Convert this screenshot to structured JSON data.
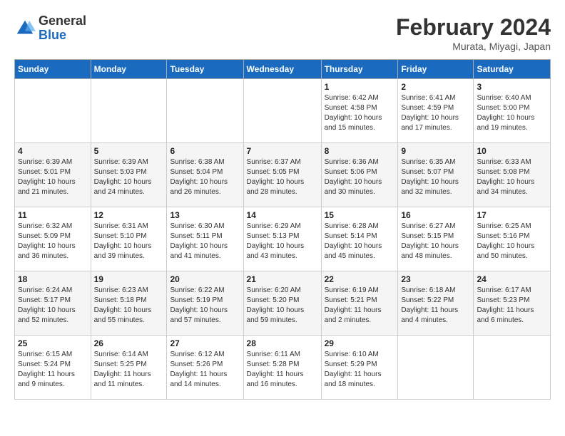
{
  "logo": {
    "general": "General",
    "blue": "Blue"
  },
  "title": {
    "main": "February 2024",
    "sub": "Murata, Miyagi, Japan"
  },
  "calendar": {
    "headers": [
      "Sunday",
      "Monday",
      "Tuesday",
      "Wednesday",
      "Thursday",
      "Friday",
      "Saturday"
    ],
    "weeks": [
      [
        {
          "day": "",
          "info": ""
        },
        {
          "day": "",
          "info": ""
        },
        {
          "day": "",
          "info": ""
        },
        {
          "day": "",
          "info": ""
        },
        {
          "day": "1",
          "info": "Sunrise: 6:42 AM\nSunset: 4:58 PM\nDaylight: 10 hours\nand 15 minutes."
        },
        {
          "day": "2",
          "info": "Sunrise: 6:41 AM\nSunset: 4:59 PM\nDaylight: 10 hours\nand 17 minutes."
        },
        {
          "day": "3",
          "info": "Sunrise: 6:40 AM\nSunset: 5:00 PM\nDaylight: 10 hours\nand 19 minutes."
        }
      ],
      [
        {
          "day": "4",
          "info": "Sunrise: 6:39 AM\nSunset: 5:01 PM\nDaylight: 10 hours\nand 21 minutes."
        },
        {
          "day": "5",
          "info": "Sunrise: 6:39 AM\nSunset: 5:03 PM\nDaylight: 10 hours\nand 24 minutes."
        },
        {
          "day": "6",
          "info": "Sunrise: 6:38 AM\nSunset: 5:04 PM\nDaylight: 10 hours\nand 26 minutes."
        },
        {
          "day": "7",
          "info": "Sunrise: 6:37 AM\nSunset: 5:05 PM\nDaylight: 10 hours\nand 28 minutes."
        },
        {
          "day": "8",
          "info": "Sunrise: 6:36 AM\nSunset: 5:06 PM\nDaylight: 10 hours\nand 30 minutes."
        },
        {
          "day": "9",
          "info": "Sunrise: 6:35 AM\nSunset: 5:07 PM\nDaylight: 10 hours\nand 32 minutes."
        },
        {
          "day": "10",
          "info": "Sunrise: 6:33 AM\nSunset: 5:08 PM\nDaylight: 10 hours\nand 34 minutes."
        }
      ],
      [
        {
          "day": "11",
          "info": "Sunrise: 6:32 AM\nSunset: 5:09 PM\nDaylight: 10 hours\nand 36 minutes."
        },
        {
          "day": "12",
          "info": "Sunrise: 6:31 AM\nSunset: 5:10 PM\nDaylight: 10 hours\nand 39 minutes."
        },
        {
          "day": "13",
          "info": "Sunrise: 6:30 AM\nSunset: 5:11 PM\nDaylight: 10 hours\nand 41 minutes."
        },
        {
          "day": "14",
          "info": "Sunrise: 6:29 AM\nSunset: 5:13 PM\nDaylight: 10 hours\nand 43 minutes."
        },
        {
          "day": "15",
          "info": "Sunrise: 6:28 AM\nSunset: 5:14 PM\nDaylight: 10 hours\nand 45 minutes."
        },
        {
          "day": "16",
          "info": "Sunrise: 6:27 AM\nSunset: 5:15 PM\nDaylight: 10 hours\nand 48 minutes."
        },
        {
          "day": "17",
          "info": "Sunrise: 6:25 AM\nSunset: 5:16 PM\nDaylight: 10 hours\nand 50 minutes."
        }
      ],
      [
        {
          "day": "18",
          "info": "Sunrise: 6:24 AM\nSunset: 5:17 PM\nDaylight: 10 hours\nand 52 minutes."
        },
        {
          "day": "19",
          "info": "Sunrise: 6:23 AM\nSunset: 5:18 PM\nDaylight: 10 hours\nand 55 minutes."
        },
        {
          "day": "20",
          "info": "Sunrise: 6:22 AM\nSunset: 5:19 PM\nDaylight: 10 hours\nand 57 minutes."
        },
        {
          "day": "21",
          "info": "Sunrise: 6:20 AM\nSunset: 5:20 PM\nDaylight: 10 hours\nand 59 minutes."
        },
        {
          "day": "22",
          "info": "Sunrise: 6:19 AM\nSunset: 5:21 PM\nDaylight: 11 hours\nand 2 minutes."
        },
        {
          "day": "23",
          "info": "Sunrise: 6:18 AM\nSunset: 5:22 PM\nDaylight: 11 hours\nand 4 minutes."
        },
        {
          "day": "24",
          "info": "Sunrise: 6:17 AM\nSunset: 5:23 PM\nDaylight: 11 hours\nand 6 minutes."
        }
      ],
      [
        {
          "day": "25",
          "info": "Sunrise: 6:15 AM\nSunset: 5:24 PM\nDaylight: 11 hours\nand 9 minutes."
        },
        {
          "day": "26",
          "info": "Sunrise: 6:14 AM\nSunset: 5:25 PM\nDaylight: 11 hours\nand 11 minutes."
        },
        {
          "day": "27",
          "info": "Sunrise: 6:12 AM\nSunset: 5:26 PM\nDaylight: 11 hours\nand 14 minutes."
        },
        {
          "day": "28",
          "info": "Sunrise: 6:11 AM\nSunset: 5:28 PM\nDaylight: 11 hours\nand 16 minutes."
        },
        {
          "day": "29",
          "info": "Sunrise: 6:10 AM\nSunset: 5:29 PM\nDaylight: 11 hours\nand 18 minutes."
        },
        {
          "day": "",
          "info": ""
        },
        {
          "day": "",
          "info": ""
        }
      ]
    ]
  }
}
